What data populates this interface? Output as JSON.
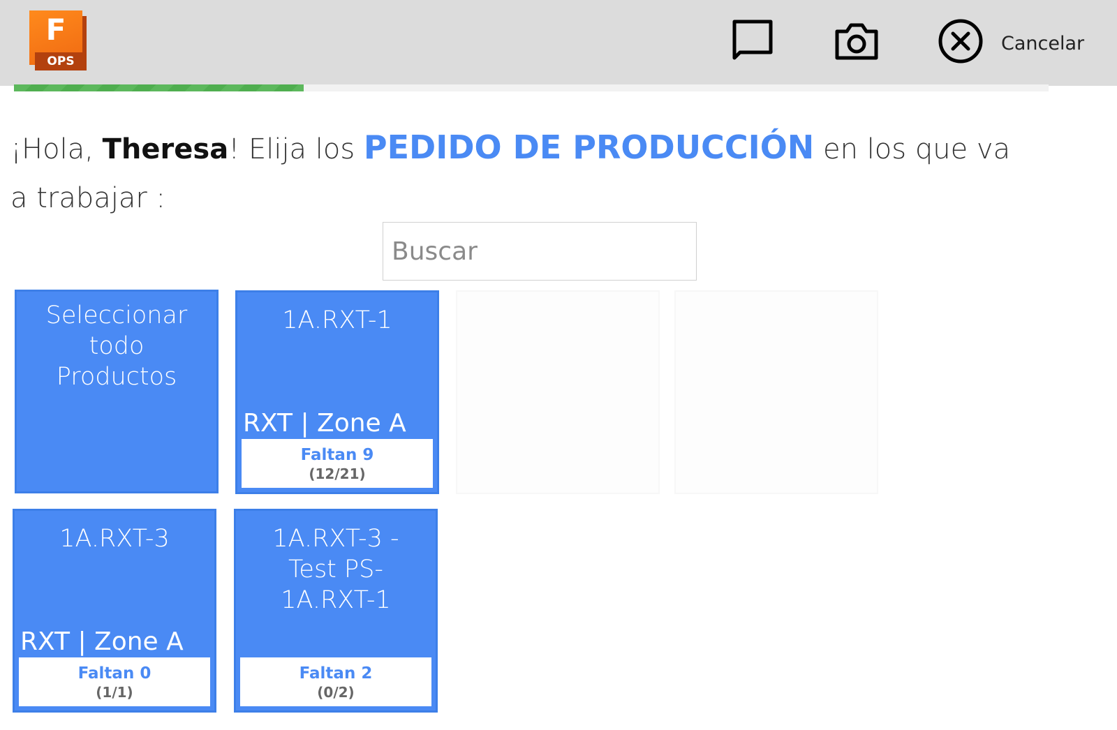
{
  "header": {
    "logo_letter": "F",
    "logo_sub": "OPS",
    "cancel_label": "Cancelar"
  },
  "progress": {
    "fraction": 0.28,
    "color": "#5cb85c"
  },
  "greeting": {
    "prefix": "¡Hola, ",
    "name": "Theresa",
    "middle": "! Elija los ",
    "highlight": "PEDIDO DE PRODUCCIÓN",
    "suffix": " en los que va a trabajar :"
  },
  "search": {
    "placeholder": "Buscar",
    "value": ""
  },
  "select_all": {
    "label": "Seleccionar todo Productos"
  },
  "orders": [
    {
      "title": "1A.RXT-1",
      "zone": "RXT | Zone A",
      "missing": "Faltan 9",
      "count": "(12/21)"
    },
    {
      "title": "1A.RXT-3",
      "zone": "RXT | Zone A",
      "missing": "Faltan 0",
      "count": "(1/1)"
    },
    {
      "title": "1A.RXT-3 - Test PS-1A.RXT-1",
      "zone": "",
      "missing": "Faltan 2",
      "count": "(0/2)"
    }
  ],
  "colors": {
    "accent": "#4a8af4",
    "topbar": "#dcdcdc",
    "logo_orange": "#f06a12"
  },
  "icons": [
    "comment-icon",
    "camera-icon",
    "close-circle-icon"
  ]
}
